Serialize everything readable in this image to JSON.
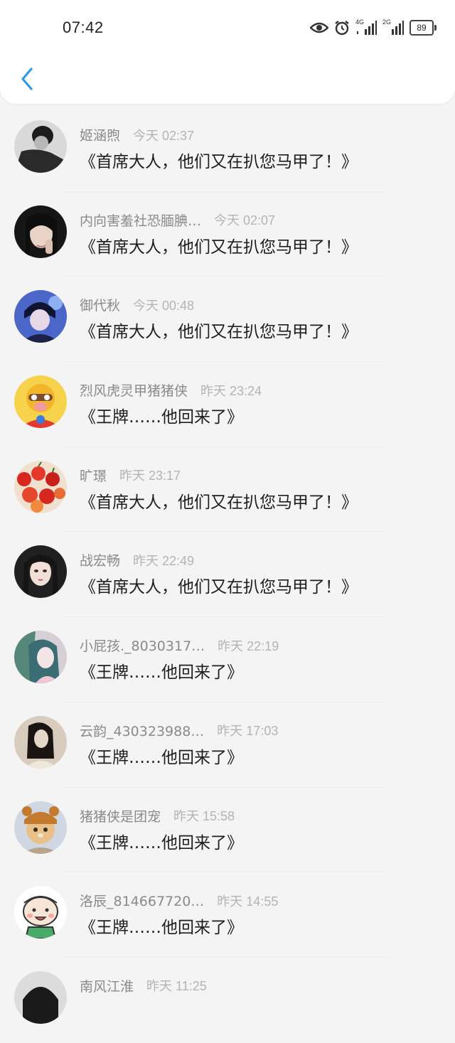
{
  "status": {
    "time": "07:42",
    "net1": "4G",
    "net2": "2G",
    "battery": "89",
    "icons": [
      "eye-icon",
      "alarm-icon",
      "signal-4g-icon",
      "signal-2g-icon",
      "battery-icon"
    ]
  },
  "nav": {
    "back_icon": "chevron-left-icon",
    "accent": "#2b9be6"
  },
  "comments": [
    {
      "name": "姬涵煦",
      "time": "今天 02:37",
      "text": "《首席大人，他们又在扒您马甲了！》",
      "avatar": "avatar-dark-portrait"
    },
    {
      "name": "内向害羞社恐腼腆…",
      "time": "今天 02:07",
      "text": "《首席大人，他们又在扒您马甲了！》",
      "avatar": "avatar-girl-hand"
    },
    {
      "name": "御代秋",
      "time": "今天 00:48",
      "text": "《首席大人，他们又在扒您马甲了！》",
      "avatar": "avatar-anime-boy"
    },
    {
      "name": "烈风虎灵甲猪猪侠",
      "time": "昨天 23:24",
      "text": "《王牌……他回来了》",
      "avatar": "avatar-cartoon-hero"
    },
    {
      "name": "旷璟",
      "time": "昨天 23:17",
      "text": "《首席大人，他们又在扒您马甲了！》",
      "avatar": "avatar-cherries"
    },
    {
      "name": "战宏畅",
      "time": "昨天 22:49",
      "text": "《首席大人，他们又在扒您马甲了！》",
      "avatar": "avatar-girl-portrait"
    },
    {
      "name": "小屁孩._8030317…",
      "time": "昨天 22:19",
      "text": "《王牌……他回来了》",
      "avatar": "avatar-anime-girl"
    },
    {
      "name": "云韵_430323988…",
      "time": "昨天 17:03",
      "text": "《王牌……他回来了》",
      "avatar": "avatar-girl-sepia"
    },
    {
      "name": "猪猪侠是团宠",
      "time": "昨天 15:58",
      "text": "《王牌……他回来了》",
      "avatar": "avatar-cat-bear"
    },
    {
      "name": "洛辰_814667720…",
      "time": "昨天 14:55",
      "text": "《王牌……他回来了》",
      "avatar": "avatar-cartoon-face"
    },
    {
      "name": "南风江淮",
      "time": "昨天 11:25",
      "text": "",
      "avatar": "avatar-dark"
    }
  ]
}
